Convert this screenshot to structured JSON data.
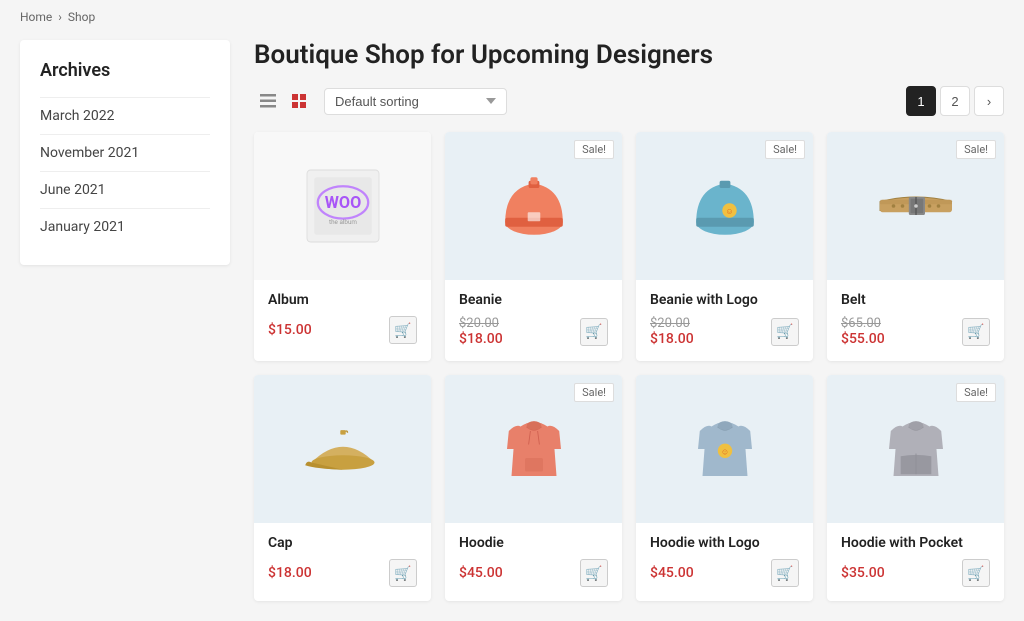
{
  "breadcrumb": {
    "home": "Home",
    "shop": "Shop",
    "sep": "›"
  },
  "sidebar": {
    "title": "Archives",
    "items": [
      {
        "label": "March 2022",
        "id": "march-2022"
      },
      {
        "label": "November 2021",
        "id": "nov-2021"
      },
      {
        "label": "June 2021",
        "id": "june-2021"
      },
      {
        "label": "January 2021",
        "id": "jan-2021"
      }
    ]
  },
  "content": {
    "title": "Boutique Shop for Upcoming Designers",
    "sort_label": "Default sorting",
    "pagination": {
      "current": "1",
      "next": "2",
      "arrow": "›"
    },
    "products": [
      {
        "id": "album",
        "name": "Album",
        "price": "$15.00",
        "original_price": null,
        "sale": false,
        "bg": "white"
      },
      {
        "id": "beanie",
        "name": "Beanie",
        "price": "$18.00",
        "original_price": "$20.00",
        "sale": true,
        "bg": "blue"
      },
      {
        "id": "beanie-logo",
        "name": "Beanie with Logo",
        "price": "$18.00",
        "original_price": "$20.00",
        "sale": true,
        "bg": "blue"
      },
      {
        "id": "belt",
        "name": "Belt",
        "price": "$55.00",
        "original_price": "$65.00",
        "sale": true,
        "bg": "blue"
      },
      {
        "id": "cap",
        "name": "Cap",
        "price": "$18.00",
        "original_price": null,
        "sale": false,
        "bg": "blue"
      },
      {
        "id": "hoodie",
        "name": "Hoodie",
        "price": "$45.00",
        "original_price": null,
        "sale": true,
        "bg": "blue"
      },
      {
        "id": "hoodie-logo",
        "name": "Hoodie with Logo",
        "price": "$45.00",
        "original_price": null,
        "sale": false,
        "bg": "blue"
      },
      {
        "id": "hoodie-pocket",
        "name": "Hoodie with Pocket",
        "price": "$35.00",
        "original_price": null,
        "sale": true,
        "bg": "blue"
      }
    ]
  }
}
